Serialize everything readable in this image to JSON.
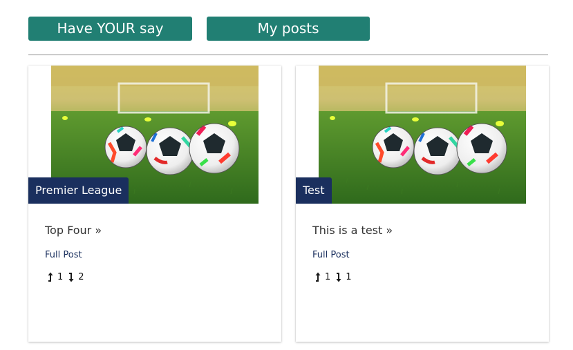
{
  "header": {
    "have_your_say_label": "Have YOUR say",
    "my_posts_label": "My posts"
  },
  "colors": {
    "button_bg": "#217f73",
    "badge_bg": "#1a2f5e",
    "link_color": "#1a2f5e"
  },
  "posts": [
    {
      "category": "Premier League",
      "title": "Top Four",
      "title_suffix": " »",
      "full_post_label": "Full Post",
      "upvotes": "1",
      "downvotes": "2",
      "image": "photo of three colorful soccer balls on grass in front of a goal"
    },
    {
      "category": "Test",
      "title": "This is a test",
      "title_suffix": " »",
      "full_post_label": "Full Post",
      "upvotes": "1",
      "downvotes": "1",
      "image": "photo of three colorful soccer balls on grass in front of a goal"
    }
  ]
}
